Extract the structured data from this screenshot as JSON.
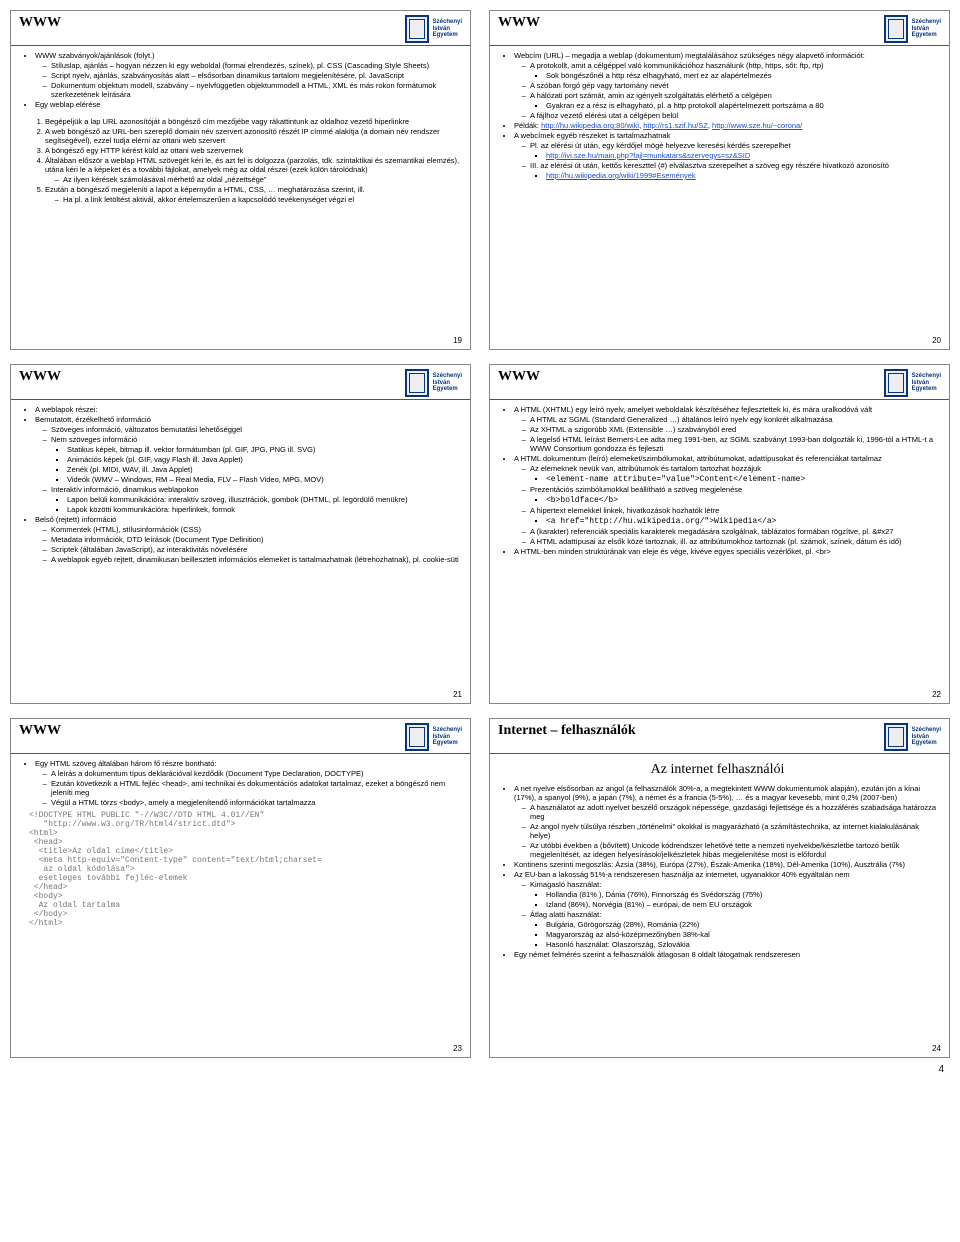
{
  "logo_text": "Széchenyi\nIstván\nEgyetem",
  "footer_page": "4",
  "slides": [
    {
      "num": "19",
      "title": "WWW",
      "b1": "WWW szabványok/ajánlások (folyt.)",
      "b1a": "Stíluslap, ajánlás – hogyan nézzen ki egy weboldal (formai elrendezés, színek), pl. CSS (Cascading Style Sheets)",
      "b1b": "Script nyelv, ajánlás, szabványosítás alatt – elsősorban dinamikus tartalom megjelenítésére, pl. JavaScript",
      "b1c": "Dokumentum objektum modell, szabvány – nyelvfüggetlen objektummodell a HTML, XML és más rokon formátumok szerkezetének leírására",
      "b2": "Egy weblap elérése",
      "n1": "Begépeljük a lap URL azonosítóját a böngésző cím mezőjébe vagy rákattintunk az oldalhoz vezető hiperlinkre",
      "n2": "A web böngésző az URL-ben szereplő domain név szervert azonosító részét IP címmé alakítja (a domain név rendszer segítségével), ezzel tudja elérni az ottani web szervert",
      "n3": "A böngésző egy HTTP kérést küld az ottani web szervernek",
      "n4": "Általában először a weblap HTML szövegét kéri le, és azt fel is dolgozza (parzolás, tdk. szintaktikai és szemantikai elemzés), utána kéri le a képeket és a további fájlokat, amelyek még az oldal részei (ezek külön tárolódnak)",
      "n4a": "Az ilyen kérések számolásával mérhető az oldal „nézettsége”",
      "n5": "Ezután a böngésző megjeleníti a lapot a képernyőn a HTML, CSS, … meghatározása szerint, ill.",
      "n5a": "Ha pl. a link letöltést aktivál, akkor értelemszerűen a kapcsolódó tevékenységet végzi el"
    },
    {
      "num": "20",
      "title": "WWW",
      "b1": "Webcím (URL) – megadja a weblap (dokumentum) megtalálásához szükséges négy alapvető információt:",
      "b1a": "A protokollt, amit a célgéppel való kommunikációhoz használunk (http, https, sőt: ftp, rtp)",
      "b1a1": "Sok böngészőnél a http rész elhagyható, mert ez az alapértelmezés",
      "b1b": "A szóban forgó gép vagy tartomány nevét",
      "b1c": "A hálózati port számát, amin az igényelt szolgáltatás elérhető a célgépen",
      "b1c1": "Gyakran ez a rész is elhagyható, pl. a http protokoll alapértelmezett portszáma a 80",
      "b1d": "A fájlhoz vezető elérési utat a célgépen belül",
      "b2": "Példák: ",
      "l2a": "http://hu.wikipedia.org:80/wiki",
      "l2b": "http://rs1.szif.hu/SZ",
      "l2c": "http://www.sze.hu/~corona/",
      "b3": "A webcímek egyéb részeket is tartalmazhatnak",
      "b3a": "Pl. az elérési út után, egy kérdőjel mögé helyezve keresési kérdés szerepelhet",
      "l3a": "http://ivi.sze.hu/main.php?fajl=munkatars&szervegys=sz&SID",
      "b3b": "III. az elérési út után, kettős kereszttel (#) elválasztva szerepelhet a szöveg egy részére hivatkozó azonosító",
      "l3b": "http://hu.wikipedia.org/wiki/1999#Események"
    },
    {
      "num": "21",
      "title": "WWW",
      "b1": "A weblapok részei:",
      "b2": "Bemutatott, érzékelhető információ",
      "b2a": "Szöveges információ, változatos bemutatási lehetőséggel",
      "b2b": "Nem szöveges információ",
      "b2b1": "Statikus képek, bitmap ill. vektor formátumban (pl. GIF, JPG, PNG ill. SVG)",
      "b2b2": "Animációs képek (pl. GIF, vagy Flash ill. Java Applet)",
      "b2b3": "Zenék (pl. MIDI, WAV, ill. Java Applet)",
      "b2b4": "Videók (WMV – Windows, RM – Real Media, FLV – Flash Video, MPG, MOV)",
      "b2c": "Interaktív információ, dinamikus weblapokon",
      "b2c1": "Lapon belüli kommunikációra: interaktív szöveg, illusztrációk, gombok (DHTML, pl. legördülő menükre)",
      "b2c2": "Lapok közötti kommunikációra: hiperlinkek, formok",
      "b3": "Belső (rejtett) információ",
      "b3a": "Kommentek (HTML), stílusinformációk (CSS)",
      "b3b": "Metadata információk, DTD leírások (Document Type Definition)",
      "b3c": "Scriptek (általában JavaScript), az interaktivitás növelésére",
      "b3d": "A weblapok egyéb rejtett, dinamikusan beillesztett információs elemeket is tartalmazhatnak (létrehozhatnak), pl. cookie-süti"
    },
    {
      "num": "22",
      "title": "WWW",
      "b1": "A HTML (XHTML) egy leíró nyelv, amelyet weboldalak készítéséhez fejlesztettek ki, és mára uralkodóvá vált",
      "b1a": "A HTML az SGML (Standard Generalized …) általános leíró nyelv egy konkrét alkalmazása",
      "b1b": "Az XHTML a szigorúbb XML (Extensible …) szabványból ered",
      "b1c": "A legelső HTML leírást Berners-Lee adta meg 1991-ben, az SGML szabványt 1993-ban dolgozták ki, 1996-tól a HTML-t a WWW Consortium gondozza és fejleszti",
      "b2": "A HTML dokumentum (leíró) elemeket/szimbólumokat, attribútumokat, adattípusokat és referenciákat tartalmaz",
      "b2a": "Az elemeknek nevük van, attribútumok és tartalom tartozhat hozzájuk",
      "code2a": "<element-name attribute=\"value\">Content</element-name>",
      "b2b": "Prezentációs szimbólumokkal beállítható a szöveg megjelenése",
      "code2b": "<b>boldface</b>",
      "b2c": "A hipertext elemekkel linkek, hivatkozások hozhatók létre",
      "code2c": "<a href=\"http://hu.wikipedia.org/\">Wikipedia</a>",
      "b2d": "A (karakter) referenciák speciális karakterek megadására szolgálnak, táblázatos formában rögzítve, pl. &#x27",
      "b2e": "A HTML adattípusai az elsők közé tartoznak, ill. az attribútumokhoz tartoznak (pl. számok, színek, dátum és idő)",
      "b3": "A HTML-ben minden struktúrának van eleje és vége, kivéve egyes speciális vezérlőket, pl. <br>"
    },
    {
      "num": "23",
      "title": "WWW",
      "b1": "Egy HTML szöveg általában három fő részre bontható:",
      "b1a": "A leírás a dokumentum típus deklarációval kezdődik (Document Type Declaration, DOCTYPE)",
      "b1b": "Ezután következik a HTML fejléc <head>, ami technikai és dokumentációs adatokat tartalmaz, ezeket a böngésző nem jeleníti meg",
      "b1c": "Végül a HTML törzs <body>, amely a megjelenítendő információkat tartalmazza",
      "code": "<!DOCTYPE HTML PUBLIC \"-//W3C//DTD HTML 4.01//EN\"\n   \"http://www.w3.org/TR/html4/strict.dtd\">\n<html>\n <head>\n  <title>Az oldal címe</title>\n  <meta http-equiv=\"Content-type\" content=\"text/html;charset=\n   az oldal kódolása\">\n  esetleges további fejléc-elemek\n </head>\n <body>\n  Az oldal tartalma\n </body>\n</html>"
    },
    {
      "num": "24",
      "title": "Internet – felhasználók",
      "subtitle": "Az internet felhasználói",
      "b1": "A net nyelve elsősorban az angol (a felhasználók 30%-a, a megtekintett WWW dokumentumok alapján), ezután jön a kínai (17%), a spanyol (9%), a japán (7%), a német és a francia (5-5%), … és a magyar kevesebb, mint 0,2% (2007-ben)",
      "b1a": "A használatot az adott nyelvet beszélő országok népessége, gazdasági fejlettsége és a hozzáférés szabadsága határozza meg",
      "b1b": "Az angol nyelv túlsúlya részben „történelmi” okokkal is magyarázható (a számítástechnika, az internet kialakulásának helye)",
      "b1c": "Az utóbbi években a (bővített) Unicode kódrendszer lehetővé tette a nemzeti nyelvekbe/készletbe tartozó betűk megjelenítését, az idegen helyesírások/jelkészletek hibás megjelenítése most is előfordul",
      "b2": "Kontinens szerinti megoszlás: Ázsia (38%), Európa (27%), Észak-Amerika (18%), Dél-Amerika (10%), Ausztrália (7%)",
      "b3": "Az EU-ban a lakosság 51%-a rendszeresen használja az internetet, ugyanakkor 40% egyáltalán nem",
      "b3a": "Kimagasló használat:",
      "b3a1": "Hollandia (81% ), Dánia (76%), Finnország és Svédország (75%)",
      "b3a2": "Izland (86%), Norvégia (81%) – európai, de nem EU országok",
      "b3b": "Átlag alatti használat:",
      "b3b1": "Bulgária, Görögország (28%), Románia (22%)",
      "b3b2": "Magyarország az alsó-középmezőnyben 38%-kal",
      "b3b3": "Hasonló használat: Olaszország, Szlovákia",
      "b4": "Egy német felmérés szerint a felhasználók átlagosan 8 oldalt látogatnak rendszeresen"
    }
  ]
}
